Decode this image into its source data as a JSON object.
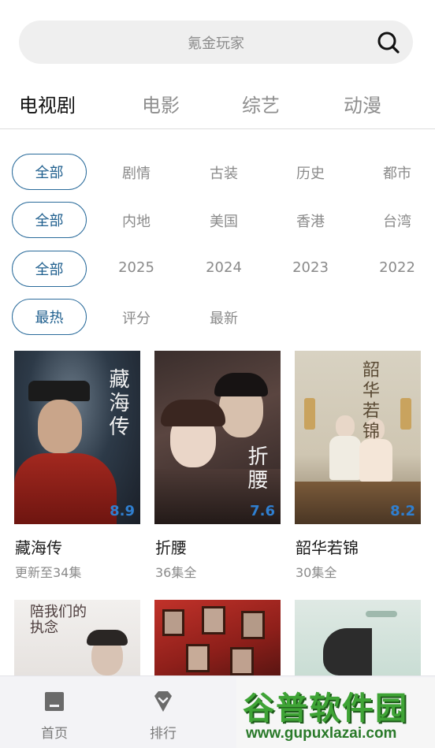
{
  "search": {
    "placeholder": "氪金玩家",
    "icon": "search-icon"
  },
  "tabs": [
    {
      "label": "电视剧",
      "active": true
    },
    {
      "label": "电影",
      "active": false
    },
    {
      "label": "综艺",
      "active": false
    },
    {
      "label": "动漫",
      "active": false
    }
  ],
  "filters": {
    "genre": {
      "selected": "全部",
      "options": [
        "剧情",
        "古装",
        "历史",
        "都市"
      ]
    },
    "region": {
      "selected": "全部",
      "options": [
        "内地",
        "美国",
        "香港",
        "台湾"
      ]
    },
    "year": {
      "selected": "全部",
      "options": [
        "2025",
        "2024",
        "2023",
        "2022"
      ]
    },
    "sort": {
      "selected": "最热",
      "options": [
        "评分",
        "最新"
      ]
    }
  },
  "cards": [
    {
      "title": "藏海传",
      "status": "更新至34集",
      "poster_text": "藏海传",
      "score": "8.9"
    },
    {
      "title": "折腰",
      "status": "36集全",
      "poster_text": "折腰",
      "score": "7.6"
    },
    {
      "title": "韶华若锦",
      "status": "30集全",
      "poster_text": "韶华若锦",
      "score": "8.2"
    },
    {
      "poster_text": "陪我们的执念"
    },
    {},
    {}
  ],
  "nav": [
    {
      "label": "首页",
      "icon": "home-icon"
    },
    {
      "label": "排行",
      "icon": "rank-diamond-icon"
    }
  ],
  "watermark": {
    "main": "谷普软件园",
    "sub": "www.gupuxlazai.com"
  },
  "colors": {
    "accent": "#1f5f8e",
    "score": "#2f7fd0",
    "muted": "#8a8a8a"
  }
}
